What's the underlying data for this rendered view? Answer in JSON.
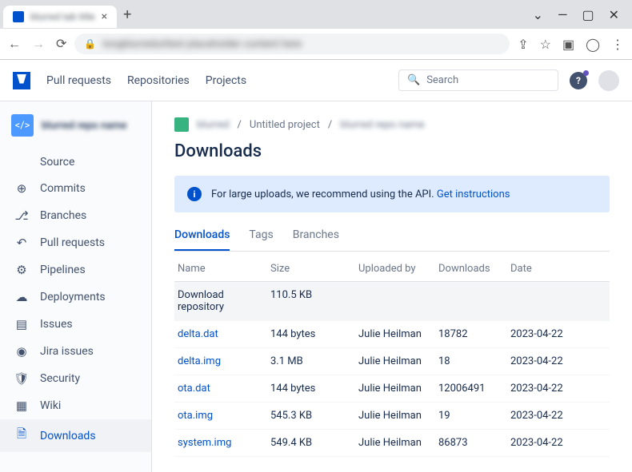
{
  "browser": {
    "tab_title": "blurred tab title"
  },
  "header": {
    "nav": [
      "Pull requests",
      "Repositories",
      "Projects"
    ],
    "search_placeholder": "Search"
  },
  "sidebar": {
    "repo_code": "</>",
    "items": [
      {
        "icon": "</>",
        "label": "Source"
      },
      {
        "icon": "⊕",
        "label": "Commits"
      },
      {
        "icon": "⎇",
        "label": "Branches"
      },
      {
        "icon": "↶",
        "label": "Pull requests"
      },
      {
        "icon": "⚙",
        "label": "Pipelines"
      },
      {
        "icon": "☁",
        "label": "Deployments"
      },
      {
        "icon": "▤",
        "label": "Issues"
      },
      {
        "icon": "◉",
        "label": "Jira issues"
      },
      {
        "icon": "🛡",
        "label": "Security"
      },
      {
        "icon": "▦",
        "label": "Wiki"
      },
      {
        "icon": "🗎",
        "label": "Downloads"
      }
    ]
  },
  "breadcrumb": {
    "blurred1": "blurred",
    "project": "Untitled project",
    "blurred2": "blurred repo name"
  },
  "page_title": "Downloads",
  "banner": {
    "text": "For large uploads, we recommend using the API.",
    "link": "Get instructions"
  },
  "tabs": [
    "Downloads",
    "Tags",
    "Branches"
  ],
  "table": {
    "headers": {
      "name": "Name",
      "size": "Size",
      "uploader": "Uploaded by",
      "downloads": "Downloads",
      "date": "Date"
    },
    "repo_row": {
      "name": "Download repository",
      "size": "110.5 KB"
    },
    "rows": [
      {
        "name": "delta.dat",
        "size": "144 bytes",
        "uploader": "Julie Heilman",
        "downloads": "18782",
        "date": "2023-04-22"
      },
      {
        "name": "delta.img",
        "size": "3.1 MB",
        "uploader": "Julie Heilman",
        "downloads": "18",
        "date": "2023-04-22"
      },
      {
        "name": "ota.dat",
        "size": "144 bytes",
        "uploader": "Julie Heilman",
        "downloads": "12006491",
        "date": "2023-04-22"
      },
      {
        "name": "ota.img",
        "size": "545.3 KB",
        "uploader": "Julie Heilman",
        "downloads": "19",
        "date": "2023-04-22"
      },
      {
        "name": "system.img",
        "size": "549.4 KB",
        "uploader": "Julie Heilman",
        "downloads": "86873",
        "date": "2023-04-22"
      }
    ]
  }
}
